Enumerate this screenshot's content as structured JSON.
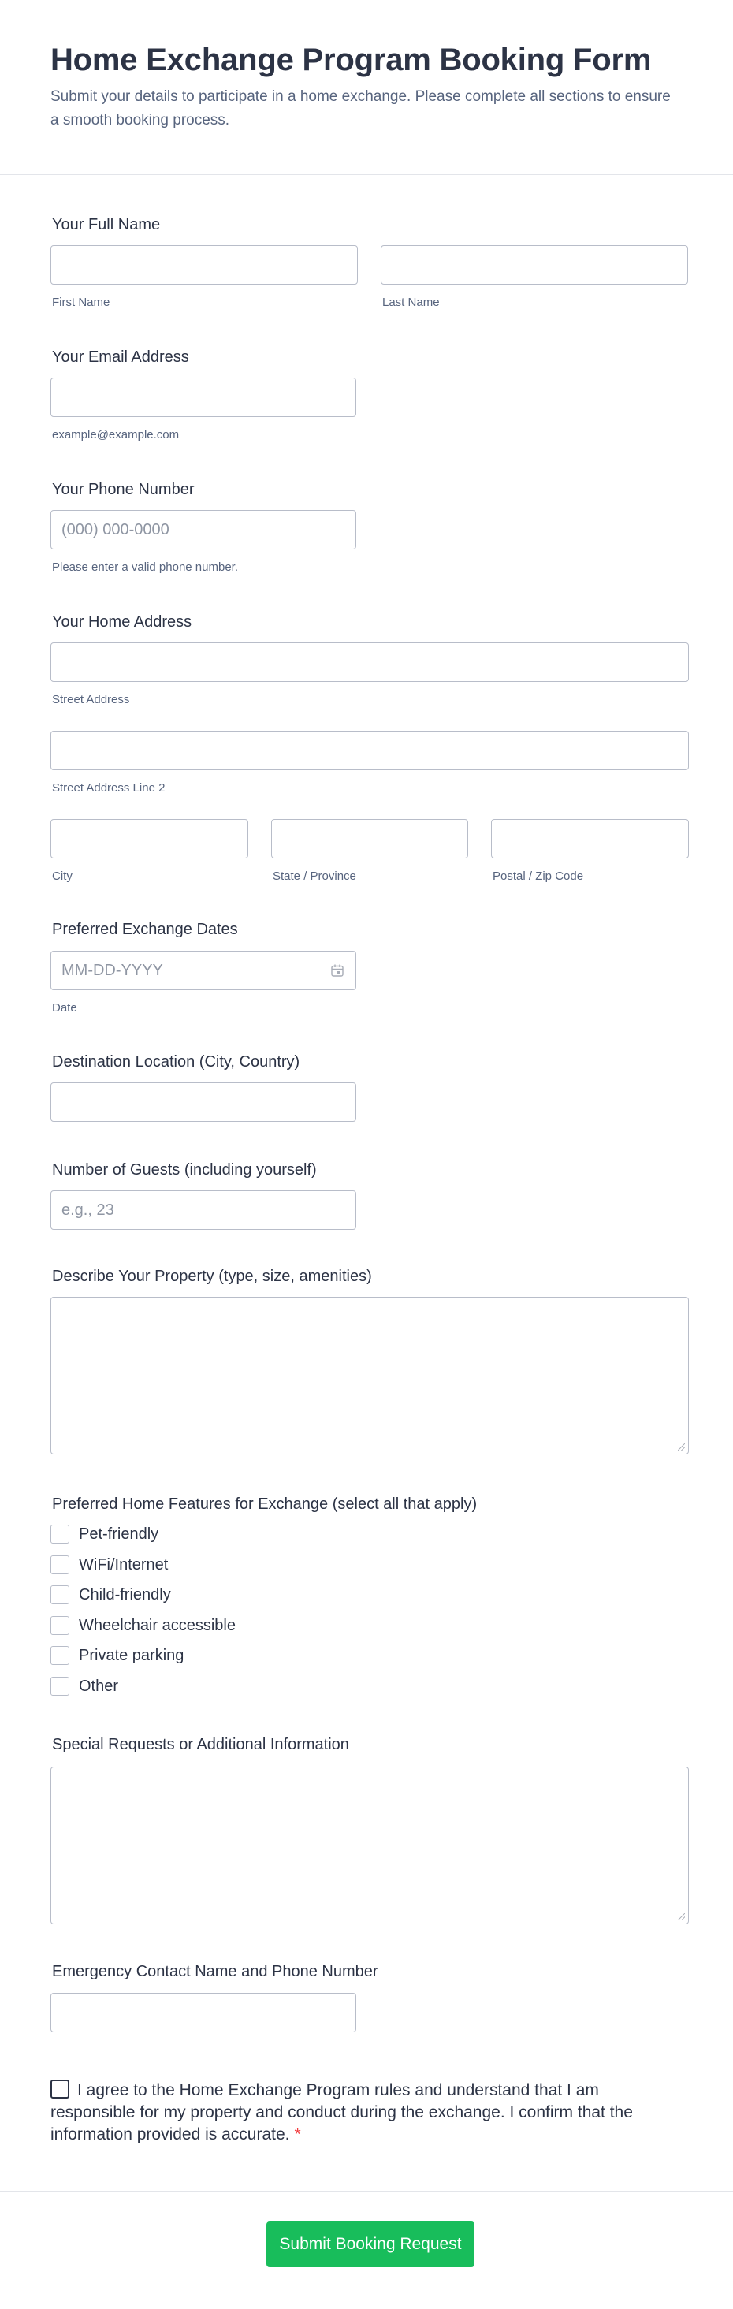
{
  "header": {
    "title": "Home Exchange Program Booking Form",
    "subtitle": "Submit your details to participate in a home exchange. Please complete all sections to ensure a smooth booking process."
  },
  "full_name": {
    "label": "Your Full Name",
    "first_sublabel": "First Name",
    "last_sublabel": "Last Name"
  },
  "email": {
    "label": "Your Email Address",
    "sublabel": "example@example.com"
  },
  "phone": {
    "label": "Your Phone Number",
    "placeholder": "(000) 000-0000",
    "sublabel": "Please enter a valid phone number."
  },
  "address": {
    "label": "Your Home Address",
    "street_sublabel": "Street Address",
    "street2_sublabel": "Street Address Line 2",
    "city_sublabel": "City",
    "state_sublabel": "State / Province",
    "zip_sublabel": "Postal / Zip Code"
  },
  "dates": {
    "label": "Preferred Exchange Dates",
    "placeholder": "MM-DD-YYYY",
    "sublabel": "Date",
    "icon": "calendar-icon"
  },
  "destination": {
    "label": "Destination Location (City, Country)"
  },
  "guests": {
    "label": "Number of Guests (including yourself)",
    "placeholder": "e.g., 23"
  },
  "property": {
    "label": "Describe Your Property (type, size, amenities)"
  },
  "features": {
    "label": "Preferred Home Features for Exchange (select all that apply)",
    "options": [
      "Pet-friendly",
      "WiFi/Internet",
      "Child-friendly",
      "Wheelchair accessible",
      "Private parking",
      "Other"
    ]
  },
  "special": {
    "label": "Special Requests or Additional Information"
  },
  "emergency": {
    "label": "Emergency Contact Name and Phone Number"
  },
  "agreement": {
    "text": "I agree to the Home Exchange Program rules and understand that I am responsible for my property and conduct during the exchange. I confirm that the information provided is accurate.",
    "required_mark": "*"
  },
  "submit": {
    "label": "Submit Booking Request",
    "color": "#18bd5b"
  }
}
